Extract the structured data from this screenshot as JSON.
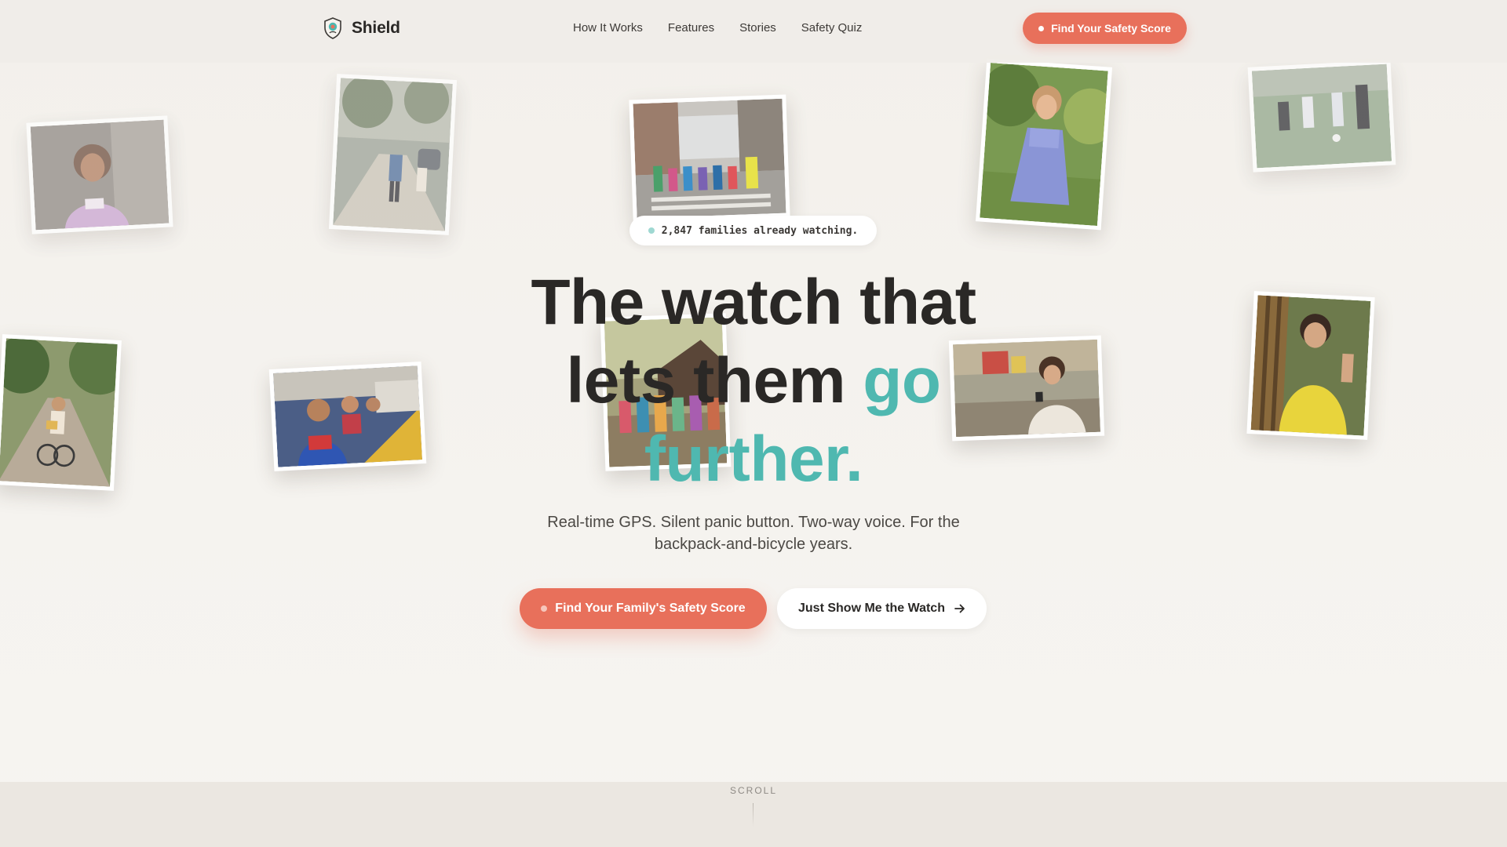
{
  "brand": {
    "name": "Shield",
    "logo_icon": "shield-logo-icon"
  },
  "nav": {
    "items": [
      {
        "label": "How It Works"
      },
      {
        "label": "Features"
      },
      {
        "label": "Stories"
      },
      {
        "label": "Safety Quiz"
      }
    ]
  },
  "header": {
    "cta_label": "Find Your Safety Score"
  },
  "hero": {
    "badge_text": "2,847 families already watching.",
    "headline_line1": "The watch that",
    "headline_line2_plain": "lets them ",
    "headline_line2_accent": "go",
    "headline_line3_accent": "further.",
    "subtitle": "Real-time GPS. Silent panic button. Two-way voice. For the backpack-and-bicycle years.",
    "primary_cta": "Find Your Family's Safety Score",
    "secondary_cta": "Just Show Me the Watch",
    "secondary_icon": "arrow-right-icon"
  },
  "scroll": {
    "label": "SCROLL"
  },
  "colors": {
    "accent_coral": "#e8705b",
    "accent_teal": "#4fb8b0",
    "text_dark": "#2a2826",
    "background": "#f4f1ec"
  }
}
